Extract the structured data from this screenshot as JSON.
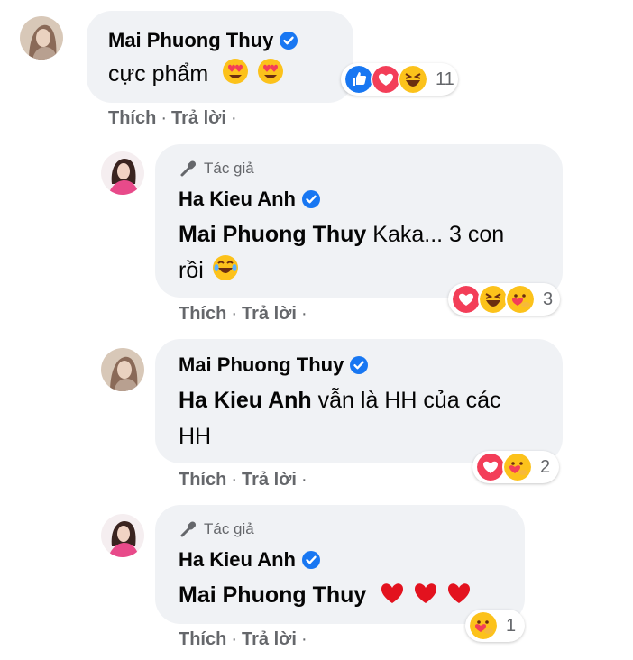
{
  "comments": [
    {
      "author": "Mai Phuong Thuy",
      "badge": "",
      "text": "cực phẩm",
      "text_emojis": [
        "heart-eyes",
        "heart-eyes"
      ],
      "reactions": {
        "icons": [
          "like",
          "love",
          "haha"
        ],
        "count": "11"
      }
    },
    {
      "author": "Ha Kieu Anh",
      "badge": "Tác giả",
      "mention": "Mai Phuong Thuy",
      "text": "Kaka... 3 con rồi",
      "text_emojis": [
        "tears-of-joy"
      ],
      "reactions": {
        "icons": [
          "love",
          "haha",
          "care"
        ],
        "count": "3"
      }
    },
    {
      "author": "Mai Phuong Thuy",
      "badge": "",
      "mention": "Ha Kieu Anh",
      "text": "vẫn là HH của các HH",
      "reactions": {
        "icons": [
          "love",
          "care"
        ],
        "count": "2"
      }
    },
    {
      "author": "Ha Kieu Anh",
      "badge": "Tác giả",
      "mention": "Mai Phuong Thuy",
      "text": "",
      "text_emojis": [
        "red-heart",
        "red-heart",
        "red-heart"
      ],
      "reactions": {
        "icons": [
          "care"
        ],
        "count": "1"
      }
    }
  ],
  "actions": {
    "like": "Thích",
    "reply": "Trả lời",
    "separator": "·"
  },
  "colors": {
    "bubble": "#f0f2f5",
    "verified": "#1877f2",
    "secondary_text": "#65676b",
    "love": "#f33e58",
    "like": "#1877f2",
    "emoji_yellow": "#fcd34d"
  }
}
